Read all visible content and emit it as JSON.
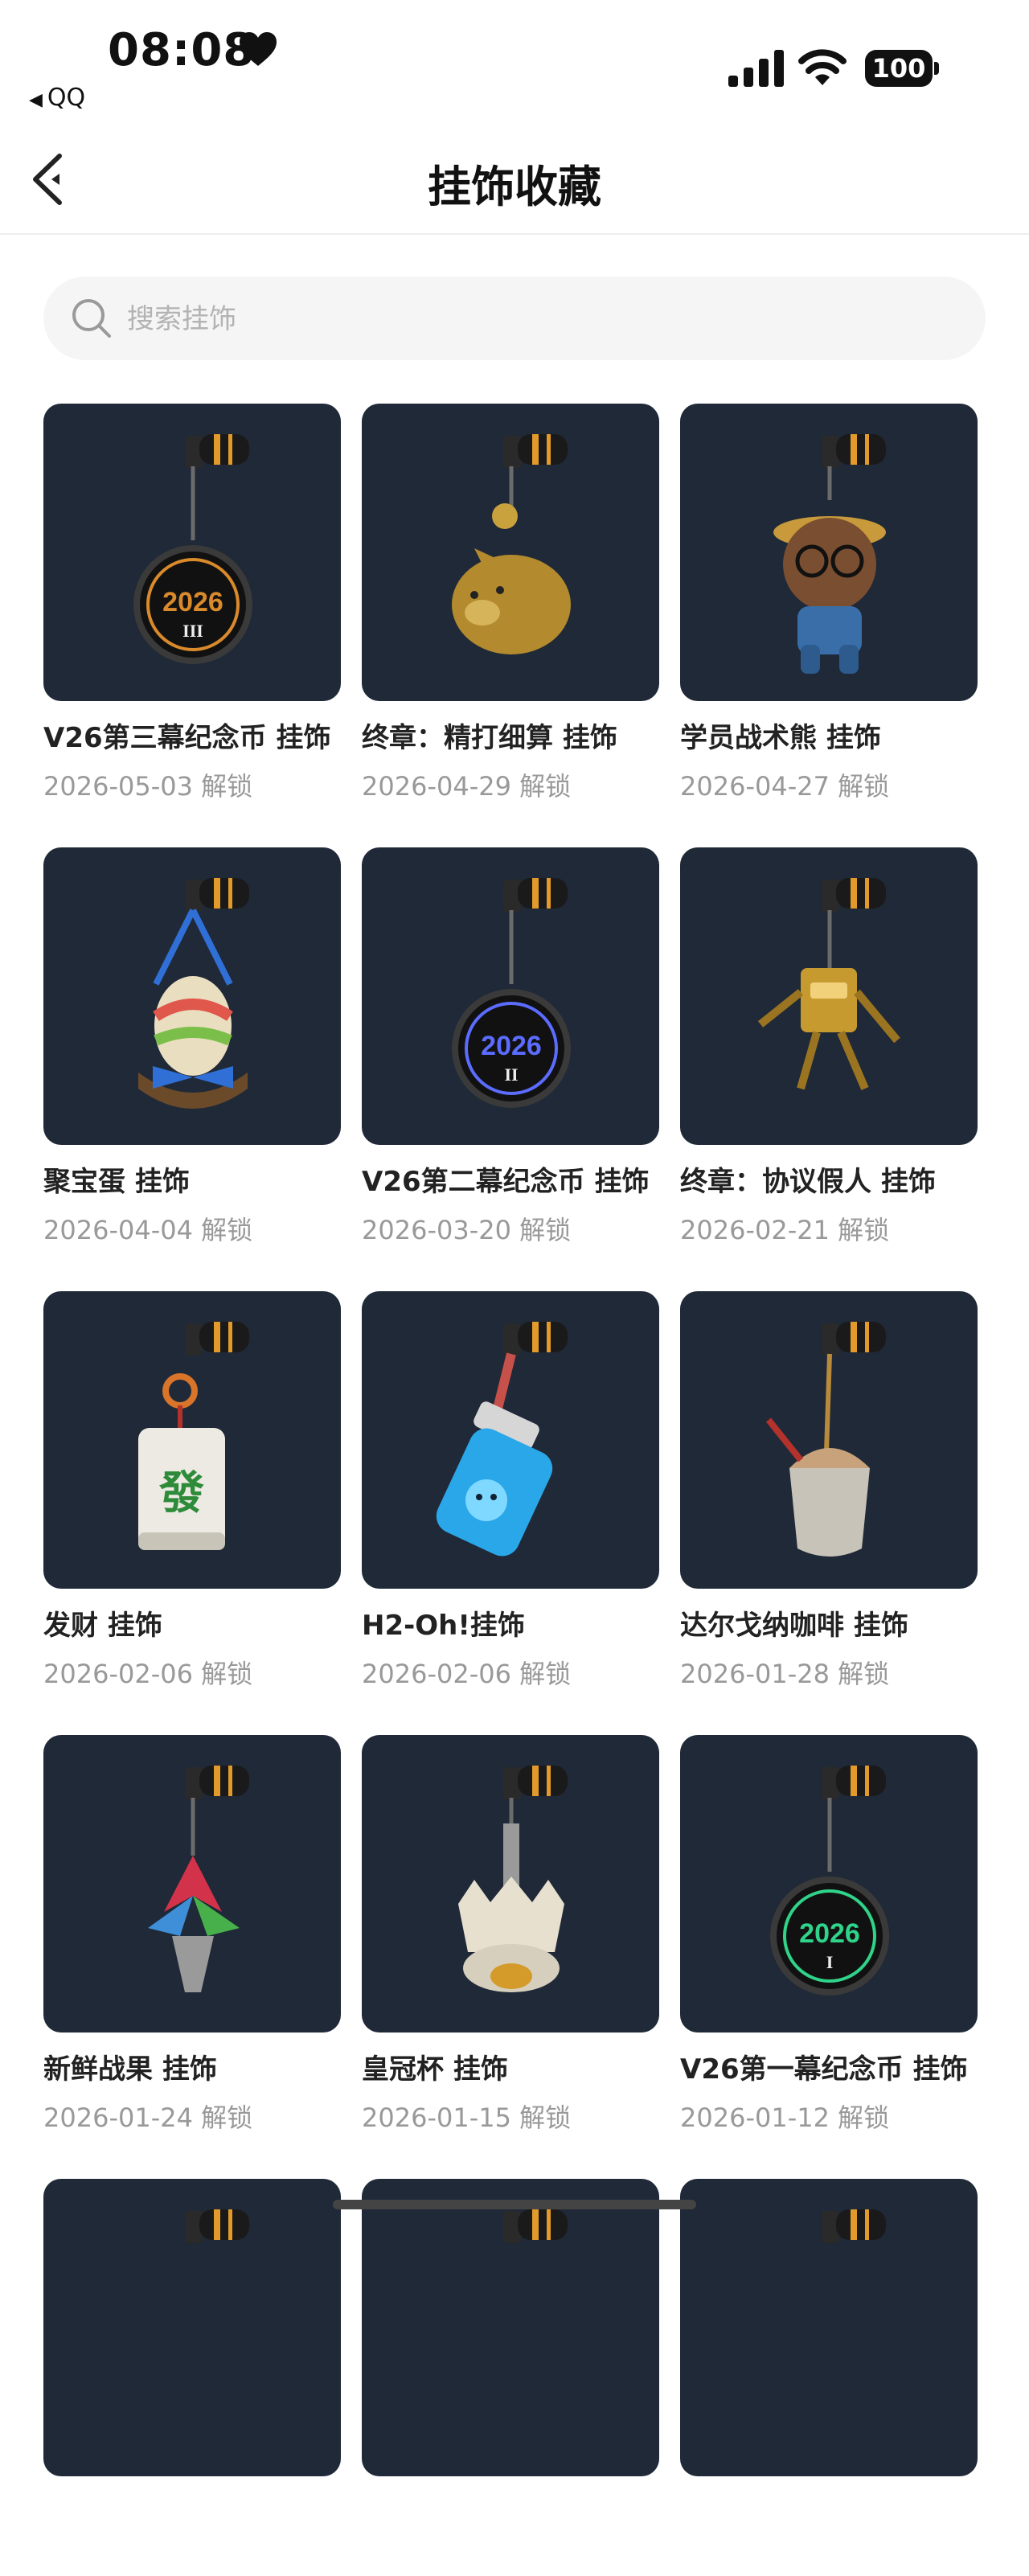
{
  "status_bar": {
    "time": "08:08",
    "back_app": "QQ",
    "battery": "100"
  },
  "header": {
    "title": "挂饰收藏"
  },
  "search": {
    "placeholder": "搜索挂饰"
  },
  "items": [
    {
      "name": "V26第三幕纪念币 挂饰",
      "date": "2026-05-03 解锁",
      "art": "coin",
      "badge_year": "2026",
      "badge_num": "III",
      "accent": "#d98a2b"
    },
    {
      "name": "终章：精打细算 挂饰",
      "date": "2026-04-29 解锁",
      "art": "pig",
      "accent": "#c9a23e"
    },
    {
      "name": "学员战术熊 挂饰",
      "date": "2026-04-27 解锁",
      "art": "bear",
      "accent": "#8b5a3c"
    },
    {
      "name": "聚宝蛋 挂饰",
      "date": "2026-04-04 解锁",
      "art": "egg",
      "accent": "#2f6fd6"
    },
    {
      "name": "V26第二幕纪念币 挂饰",
      "date": "2026-03-20 解锁",
      "art": "coin",
      "badge_year": "2026",
      "badge_num": "II",
      "accent": "#5b6cff"
    },
    {
      "name": "终章：协议假人 挂饰",
      "date": "2026-02-21 解锁",
      "art": "robot",
      "accent": "#d4a83a"
    },
    {
      "name": "发财 挂饰",
      "date": "2026-02-06 解锁",
      "art": "mahjong",
      "badge_year": "發",
      "accent": "#2e8b3a"
    },
    {
      "name": "H2-Oh!挂饰",
      "date": "2026-02-06 解锁",
      "art": "bottle",
      "accent": "#2aa7e8"
    },
    {
      "name": "达尔戈纳咖啡 挂饰",
      "date": "2026-01-28 解锁",
      "art": "coffee",
      "accent": "#c7a27a"
    },
    {
      "name": "新鲜战果 挂饰",
      "date": "2026-01-24 解锁",
      "art": "flower",
      "accent": "#d2334a"
    },
    {
      "name": "皇冠杯 挂饰",
      "date": "2026-01-15 解锁",
      "art": "crown",
      "accent": "#e8e0cf"
    },
    {
      "name": "V26第一幕纪念币 挂饰",
      "date": "2026-01-12 解锁",
      "art": "coin",
      "badge_year": "2026",
      "badge_num": "I",
      "accent": "#2fd38a"
    },
    {
      "name": "",
      "date": "",
      "art": "partial"
    },
    {
      "name": "",
      "date": "",
      "art": "partial"
    },
    {
      "name": "",
      "date": "",
      "art": "partial"
    }
  ]
}
